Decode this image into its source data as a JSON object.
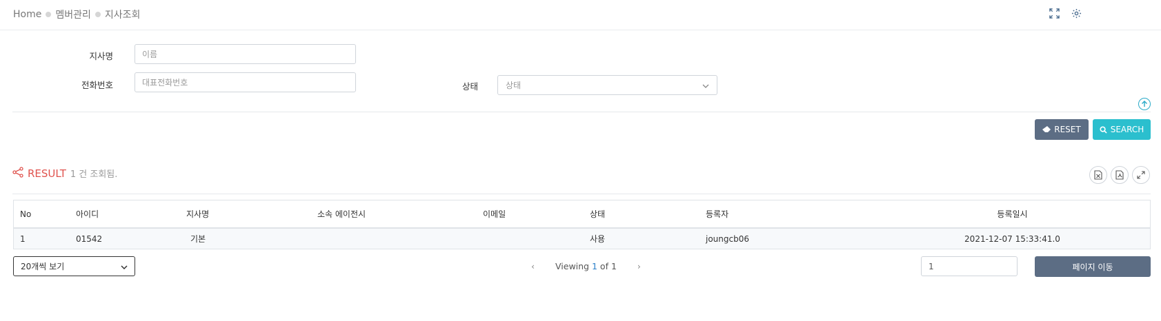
{
  "breadcrumb": {
    "home": "Home",
    "section": "멤버관리",
    "page": "지사조회"
  },
  "top_icons": [
    "expand-icon",
    "settings-gear-icon"
  ],
  "search": {
    "branch_name_label": "지사명",
    "branch_name_placeholder": "이름",
    "phone_label": "전화번호",
    "phone_placeholder": "대표전화번호",
    "status_label": "상태",
    "status_selected": "상태"
  },
  "buttons": {
    "reset": "RESET",
    "search": "SEARCH"
  },
  "result": {
    "title": "RESULT",
    "count_text": "1 건 조회됨."
  },
  "table": {
    "columns": [
      "No",
      "아이디",
      "지사명",
      "소속 에이전시",
      "이메일",
      "상태",
      "등록자",
      "등록일시"
    ],
    "rows": [
      [
        "1",
        "01542",
        "기본",
        "",
        "",
        "사용",
        "joungcb06",
        "2021-12-07 15:33:41.0"
      ]
    ]
  },
  "pagination": {
    "page_size": "20개씩 보기",
    "viewing_prefix": "Viewing",
    "current_page": "1",
    "of_text": "of 1",
    "goto_value": "1",
    "goto_button": "페이지 이동"
  },
  "colors": {
    "accent_red": "#e0534e",
    "search_btn": "#2bbfce",
    "reset_btn": "#5c6d84",
    "page_link": "#2a7fc9"
  }
}
